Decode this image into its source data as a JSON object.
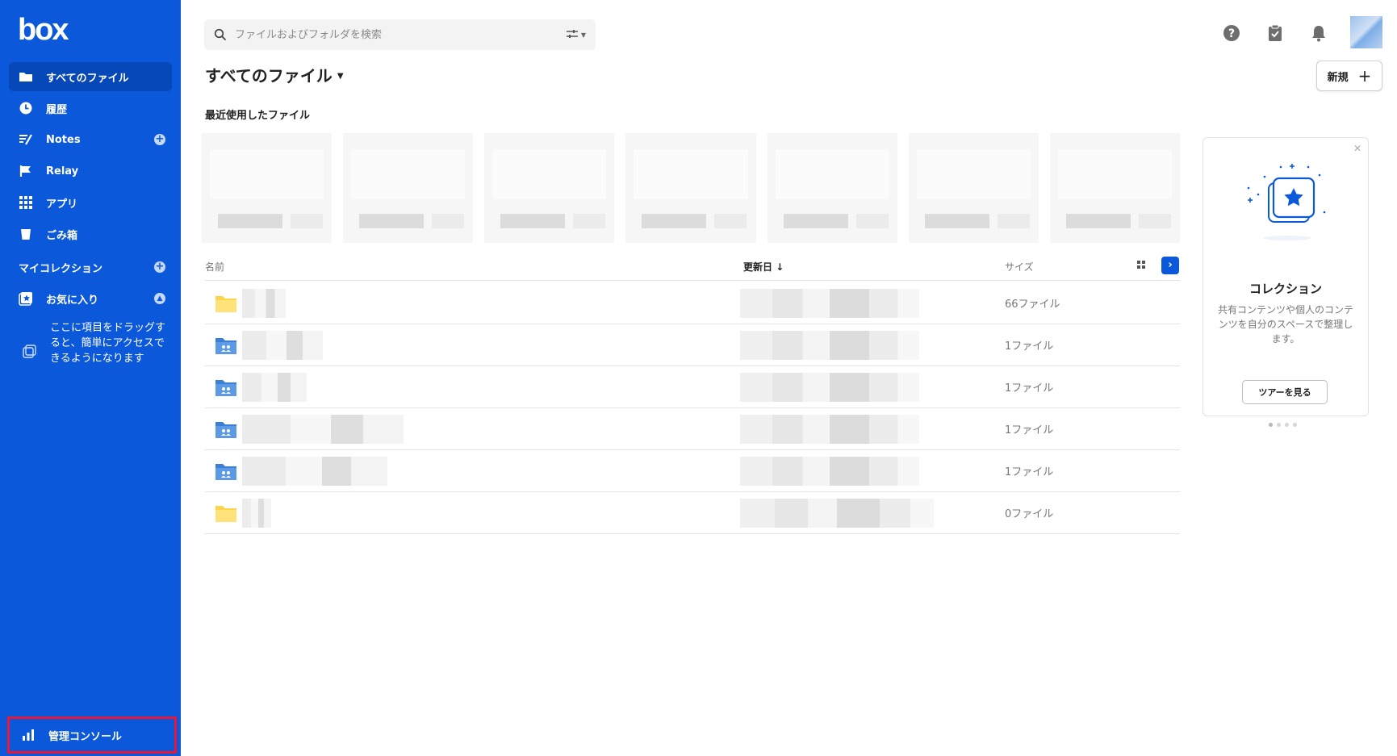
{
  "app": {
    "logo": "box"
  },
  "sidebar": {
    "items": [
      {
        "label": "すべてのファイル",
        "icon": "folder-icon"
      },
      {
        "label": "履歴",
        "icon": "clock-icon"
      },
      {
        "label": "Notes",
        "icon": "notes-icon"
      },
      {
        "label": "Relay",
        "icon": "relay-icon"
      },
      {
        "label": "アプリ",
        "icon": "apps-grid-icon"
      },
      {
        "label": "ごみ箱",
        "icon": "trash-icon"
      }
    ],
    "collections_label": "マイコレクション",
    "favorites_label": "お気に入り",
    "favorites_hint": "ここに項目をドラッグすると、簡単にアクセスできるようになります",
    "admin_console_label": "管理コンソール"
  },
  "search": {
    "placeholder": "ファイルおよびフォルダを検索"
  },
  "header": {
    "icons": [
      "help-icon",
      "tasks-icon",
      "bell-icon"
    ]
  },
  "main": {
    "title": "すべてのファイル",
    "new_button": "新規",
    "recent_title": "最近使用したファイル",
    "table": {
      "col_name": "名前",
      "col_date": "更新日",
      "col_size": "サイズ",
      "rows": [
        {
          "type": "folder",
          "size": "66ファイル"
        },
        {
          "type": "shared-folder",
          "size": "1ファイル"
        },
        {
          "type": "shared-folder",
          "size": "1ファイル"
        },
        {
          "type": "shared-folder",
          "size": "1ファイル"
        },
        {
          "type": "shared-folder",
          "size": "1ファイル"
        },
        {
          "type": "folder",
          "size": "0ファイル"
        }
      ]
    }
  },
  "collection_card": {
    "title": "コレクション",
    "description": "共有コンテンツや個人のコンテンツを自分のスペースで整理します。",
    "tour_button": "ツアーを見る"
  },
  "colors": {
    "brand": "#0b59da",
    "highlight": "#e8173a",
    "folder_yellow": "#ffd44d",
    "folder_blue": "#4a90e2"
  }
}
